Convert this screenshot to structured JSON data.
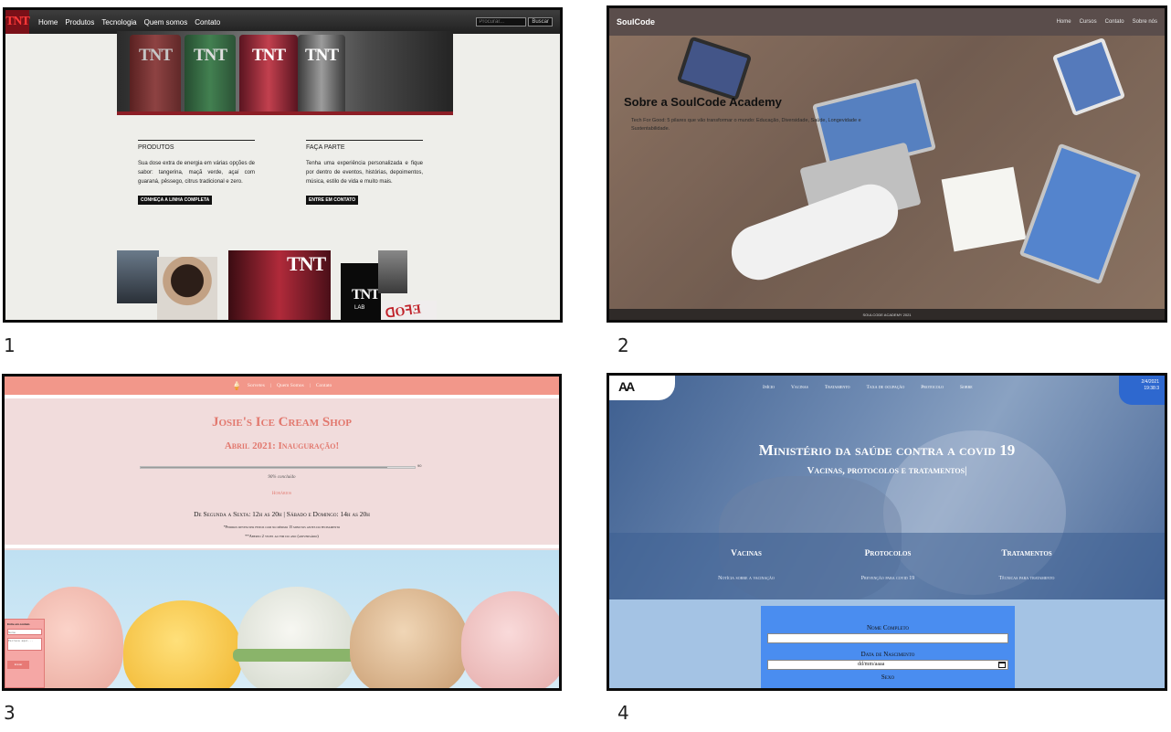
{
  "labels": [
    "1",
    "2",
    "3",
    "4"
  ],
  "tnt": {
    "logo": "TNT",
    "nav": [
      "Home",
      "Produtos",
      "Tecnologia",
      "Quem somos",
      "Contato"
    ],
    "search_placeholder": "Procurar...",
    "search_button": "Buscar",
    "can_text": "TNT",
    "cards": [
      {
        "title": "PRODUTOS",
        "text": "Sua dose extra de energia em várias opções de sabor: tangerina, maçã verde, açaí com guaraná, pêssego, citrus tradicional e zero.",
        "button": "CONHEÇA A LINHA COMPLETA"
      },
      {
        "title": "FAÇA PARTE",
        "text": "Tenha uma experiência personalizada e fique por dentro de eventos, histórias, depoimentos, música, estilo de vida e muito mais.",
        "button": "ENTRE EM CONTATO"
      }
    ],
    "photo_sign": "TNT",
    "photo_sign2": "LAB"
  },
  "soulcode": {
    "brand": "SoulCode",
    "nav": [
      "Home",
      "Cursos",
      "Contato",
      "Sobre nós"
    ],
    "heading": "Sobre a SoulCode Academy",
    "description": "Tech For Good: 5 pilares que vão transformar o mundo: Educação, Diversidade, Saúde, Longevidade e Sustentabilidade.",
    "footer": "SOULCODE ACADEMY 2021"
  },
  "josie": {
    "nav": [
      "Sorvetes",
      "Quem Somos",
      "Contato"
    ],
    "title": "Josie's Ice Cream Shop",
    "subtitle": "Abril 2021: Inauguração!",
    "progress_label": "90",
    "progress_value": 0.9,
    "progress_caption": "90% concluído",
    "hours_title": "Horários",
    "hours": "De Segunda a Sexta: 12h as 20h | Sábado e Domingo: 14h as 20h",
    "note1": "*Pedidos devem ser feitos com no mínimo 15 minutos antes do fechamento",
    "note2": "**Aberto 2 vezes ao fim do ano (aniversário)",
    "form": {
      "title": "Entre em contato",
      "name_placeholder": "Nome",
      "message_placeholder": "Escreva aqui...",
      "button": "Enviar"
    }
  },
  "ministerio": {
    "logo": "AA",
    "nav": [
      "Início",
      "Vacinas",
      "Tratamento",
      "Taxa de ocupação",
      "Protocolo",
      "Sobre"
    ],
    "date": "2/4/2021",
    "time": "19:38:3",
    "heading": "Ministério da saúde contra a covid 19",
    "subheading": "Vacinas, protocolos e tratamentos|",
    "cards": [
      {
        "title": "Vacinas",
        "link": "Notícia sobre a vacinação"
      },
      {
        "title": "Protocolos",
        "link": "Prevenção para covid 19"
      },
      {
        "title": "Tratamentos",
        "link": "Técnicas para tratamento"
      }
    ],
    "form": {
      "name_label": "Nome Completo",
      "birth_label": "Data de Nascimento",
      "birth_placeholder": "dd/mm/aaaa",
      "sex_label": "Sexo"
    }
  }
}
